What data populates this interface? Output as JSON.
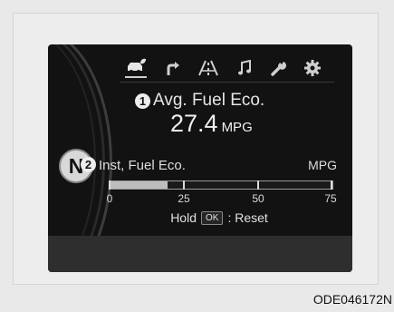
{
  "iconbar": {
    "icons": [
      "eco-car-icon",
      "turn-arrow-icon",
      "road-lane-icon",
      "music-note-icon",
      "wrench-icon",
      "gear-icon"
    ],
    "active": "eco-car-icon"
  },
  "avg": {
    "badge": "1",
    "label": "Avg. Fuel Eco.",
    "value": "27.4",
    "unit": "MPG"
  },
  "gear": {
    "label": "N"
  },
  "inst": {
    "badge": "2",
    "label": "Inst, Fuel Eco.",
    "unit": "MPG",
    "bar_fraction": 0.26,
    "scale": [
      "0",
      "25",
      "50",
      "75"
    ]
  },
  "reset": {
    "hold": "Hold",
    "key": "OK",
    "action": ": Reset"
  },
  "caption": "ODE046172N",
  "colors": {
    "screen_bg": "#121212",
    "text": "#e6e6e6",
    "bar_fill": "#bdbdbd"
  }
}
